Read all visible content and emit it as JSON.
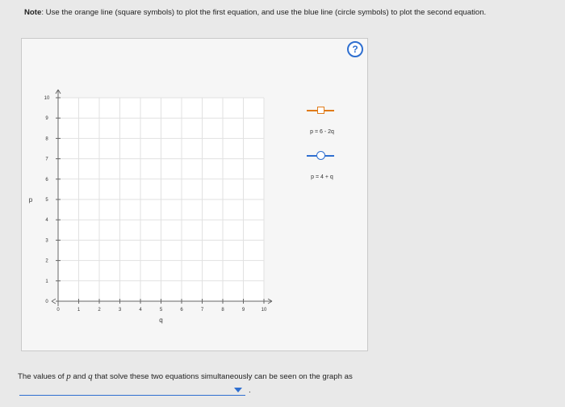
{
  "note": {
    "label": "Note",
    "text": ": Use the orange line (square symbols) to plot the first equation, and use the blue line (circle symbols) to plot the second equation."
  },
  "help": {
    "label": "?"
  },
  "graph": {
    "x_axis_label": "q",
    "y_axis_label": "p",
    "x_ticks": [
      "0",
      "1",
      "2",
      "3",
      "4",
      "5",
      "6",
      "7",
      "8",
      "9",
      "10"
    ],
    "y_ticks": [
      "0",
      "1",
      "2",
      "3",
      "4",
      "5",
      "6",
      "7",
      "8",
      "9",
      "10"
    ],
    "x_range": [
      0,
      10
    ],
    "y_range": [
      0,
      10
    ]
  },
  "legend": {
    "items": [
      {
        "label": "p = 6 - 2q",
        "color": "#e07b1a",
        "symbol": "square-icon"
      },
      {
        "label": "p = 4 + q",
        "color": "#2f6fd0",
        "symbol": "circle-icon"
      }
    ]
  },
  "question": {
    "prefix": "The values of ",
    "var_p": "p",
    "mid": " and ",
    "var_q": "q",
    "suffix": " that solve these two equations simultaneously can be seen on the graph as"
  },
  "answer_dropdown": {
    "selected": ""
  },
  "after_dropdown": "."
}
